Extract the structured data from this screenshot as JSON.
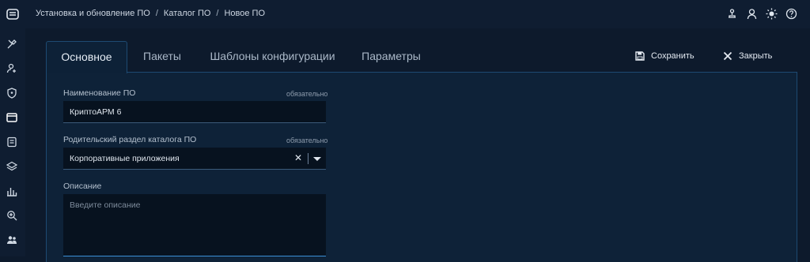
{
  "breadcrumb": [
    "Установка и обновление ПО",
    "Каталог ПО",
    "Новое ПО"
  ],
  "tabs": [
    "Основное",
    "Пакеты",
    "Шаблоны конфигурации",
    "Параметры"
  ],
  "actions": {
    "save": "Сохранить",
    "close": "Закрыть"
  },
  "form": {
    "name": {
      "label": "Наименование ПО",
      "required": "обязательно",
      "value": "КриптоАРМ 6"
    },
    "parent": {
      "label": "Родительский раздел каталога ПО",
      "required": "обязательно",
      "value": "Корпоративные приложения"
    },
    "description": {
      "label": "Описание",
      "placeholder": "Введите описание"
    }
  },
  "sidebar_icons": [
    "tools-icon",
    "user-settings-icon",
    "shield-icon",
    "window-icon",
    "document-icon",
    "layers-icon",
    "bar-chart-icon",
    "search-zoom-icon",
    "users-icon"
  ],
  "top_icons": [
    "network-icon",
    "user-icon",
    "theme-sun-icon",
    "help-icon"
  ],
  "colors": {
    "background": "#0d1a2c",
    "panel_border": "#1d4a72",
    "focus": "#3b8fd6"
  }
}
